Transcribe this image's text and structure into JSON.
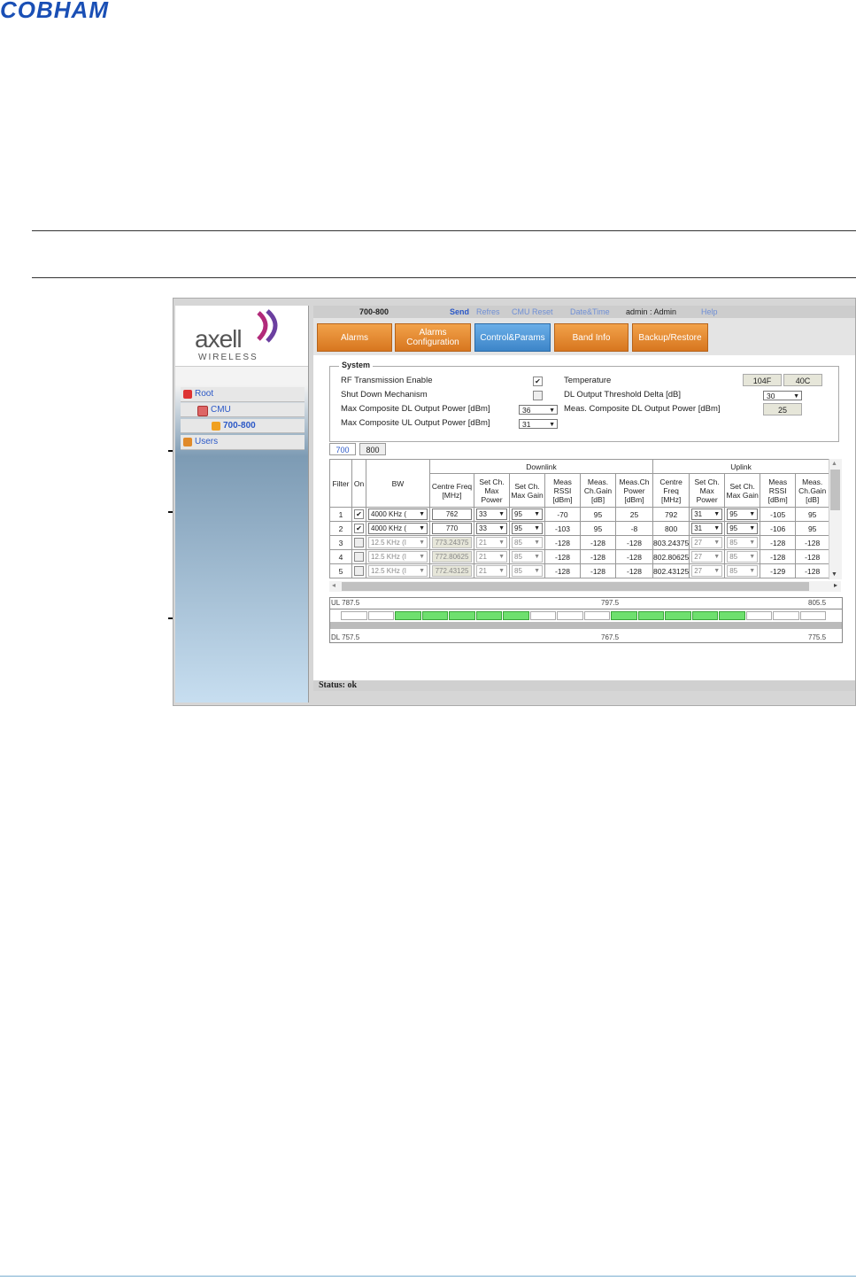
{
  "doc": {
    "logo_text": "COBHAM"
  },
  "colors": {
    "cobham_blue": "#1a4fb5",
    "orange_tab": "#e5892d",
    "active_tab": "#4a90d6",
    "green_cell": "#6ee06e",
    "link_blue": "#2b58c7"
  },
  "app": {
    "brand": {
      "name": "axell",
      "sub": "WIRELESS"
    },
    "tree": [
      {
        "label": "Root",
        "icon": "root-icon"
      },
      {
        "label": "CMU",
        "icon": "cmu-icon"
      },
      {
        "label": "700-800",
        "icon": "warning-icon"
      },
      {
        "label": "Users",
        "icon": "users-icon"
      }
    ],
    "topbar": {
      "device": "700-800",
      "send": "Send",
      "refresh": "Refres",
      "cmu_reset": "CMU Reset",
      "datetime": "Date&Time",
      "user": "admin : Admin",
      "help": "Help"
    },
    "tabs": [
      "Alarms",
      "Alarms Configuration",
      "Control&Params",
      "Band Info",
      "Backup/Restore"
    ],
    "active_tab": "Control&Params",
    "system": {
      "legend": "System",
      "rf_enable_label": "RF Transmission Enable",
      "rf_enable_checked": true,
      "shutdown_label": "Shut Down Mechanism",
      "shutdown_checked": false,
      "max_dl_label": "Max Composite DL Output Power [dBm]",
      "max_dl_value": "36",
      "max_ul_label": "Max Composite UL Output Power [dBm]",
      "max_ul_value": "31",
      "temperature_label": "Temperature",
      "temp_f": "104F",
      "temp_c": "40C",
      "dl_threshold_label": "DL Output Threshold Delta [dB]",
      "dl_threshold_value": "30",
      "meas_dl_label": "Meas. Composite DL Output Power [dBm]",
      "meas_dl_value": "25"
    },
    "bands": [
      "700",
      "800"
    ],
    "active_band": "700",
    "table": {
      "group_dl": "Downlink",
      "group_ul": "Uplink",
      "headers": {
        "filter": "Filter",
        "on": "On",
        "bw": "BW",
        "dl_freq": "Centre Freq [MHz]",
        "dl_setmax": "Set Ch. Max Power",
        "dl_setgain": "Set Ch. Max Gain",
        "dl_rssi": "Meas RSSI [dBm]",
        "dl_chgain": "Meas. Ch.Gain [dB]",
        "dl_chpower": "Meas.Ch Power [dBm]",
        "ul_freq": "Centre Freq [MHz]",
        "ul_setmax": "Set Ch. Max Power",
        "ul_setgain": "Set Ch. Max Gain",
        "ul_rssi": "Meas RSSI [dBm]",
        "ul_chgain": "Meas. Ch.Gain [dB]"
      },
      "rows": [
        {
          "filter": "1",
          "on": true,
          "bw": "4000 KHz (",
          "dl_freq": "762",
          "dl_setmax": "33",
          "dl_setgain": "95",
          "dl_rssi": "-70",
          "dl_chgain": "95",
          "dl_chpower": "25",
          "ul_freq": "792",
          "ul_setmax": "31",
          "ul_setgain": "95",
          "ul_rssi": "-105",
          "ul_chgain": "95"
        },
        {
          "filter": "2",
          "on": true,
          "bw": "4000 KHz (",
          "dl_freq": "770",
          "dl_setmax": "33",
          "dl_setgain": "95",
          "dl_rssi": "-103",
          "dl_chgain": "95",
          "dl_chpower": "-8",
          "ul_freq": "800",
          "ul_setmax": "31",
          "ul_setgain": "95",
          "ul_rssi": "-106",
          "ul_chgain": "95"
        },
        {
          "filter": "3",
          "on": false,
          "bw": "12.5 KHz (I",
          "dl_freq": "773.24375",
          "dl_setmax": "21",
          "dl_setgain": "85",
          "dl_rssi": "-128",
          "dl_chgain": "-128",
          "dl_chpower": "-128",
          "ul_freq": "803.24375",
          "ul_setmax": "27",
          "ul_setgain": "85",
          "ul_rssi": "-128",
          "ul_chgain": "-128"
        },
        {
          "filter": "4",
          "on": false,
          "bw": "12.5 KHz (I",
          "dl_freq": "772.80625",
          "dl_setmax": "21",
          "dl_setgain": "85",
          "dl_rssi": "-128",
          "dl_chgain": "-128",
          "dl_chpower": "-128",
          "ul_freq": "802.80625",
          "ul_setmax": "27",
          "ul_setgain": "85",
          "ul_rssi": "-128",
          "ul_chgain": "-128"
        },
        {
          "filter": "5",
          "on": false,
          "bw": "12.5 KHz (I",
          "dl_freq": "772.43125",
          "dl_setmax": "21",
          "dl_setgain": "85",
          "dl_rssi": "-128",
          "dl_chgain": "-128",
          "dl_chpower": "-128",
          "ul_freq": "802.43125",
          "ul_setmax": "27",
          "ul_setgain": "85",
          "ul_rssi": "-129",
          "ul_chgain": "-128"
        }
      ]
    },
    "spectrum": {
      "ul_start": "UL 787.5",
      "ul_mid": "797.5",
      "ul_end": "805.5",
      "dl_start": "DL 757.5",
      "dl_mid": "767.5",
      "dl_end": "775.5",
      "cells": [
        false,
        false,
        true,
        true,
        true,
        true,
        true,
        false,
        false,
        false,
        true,
        true,
        true,
        true,
        true,
        false,
        false,
        false
      ]
    },
    "status": "Status: ok"
  }
}
